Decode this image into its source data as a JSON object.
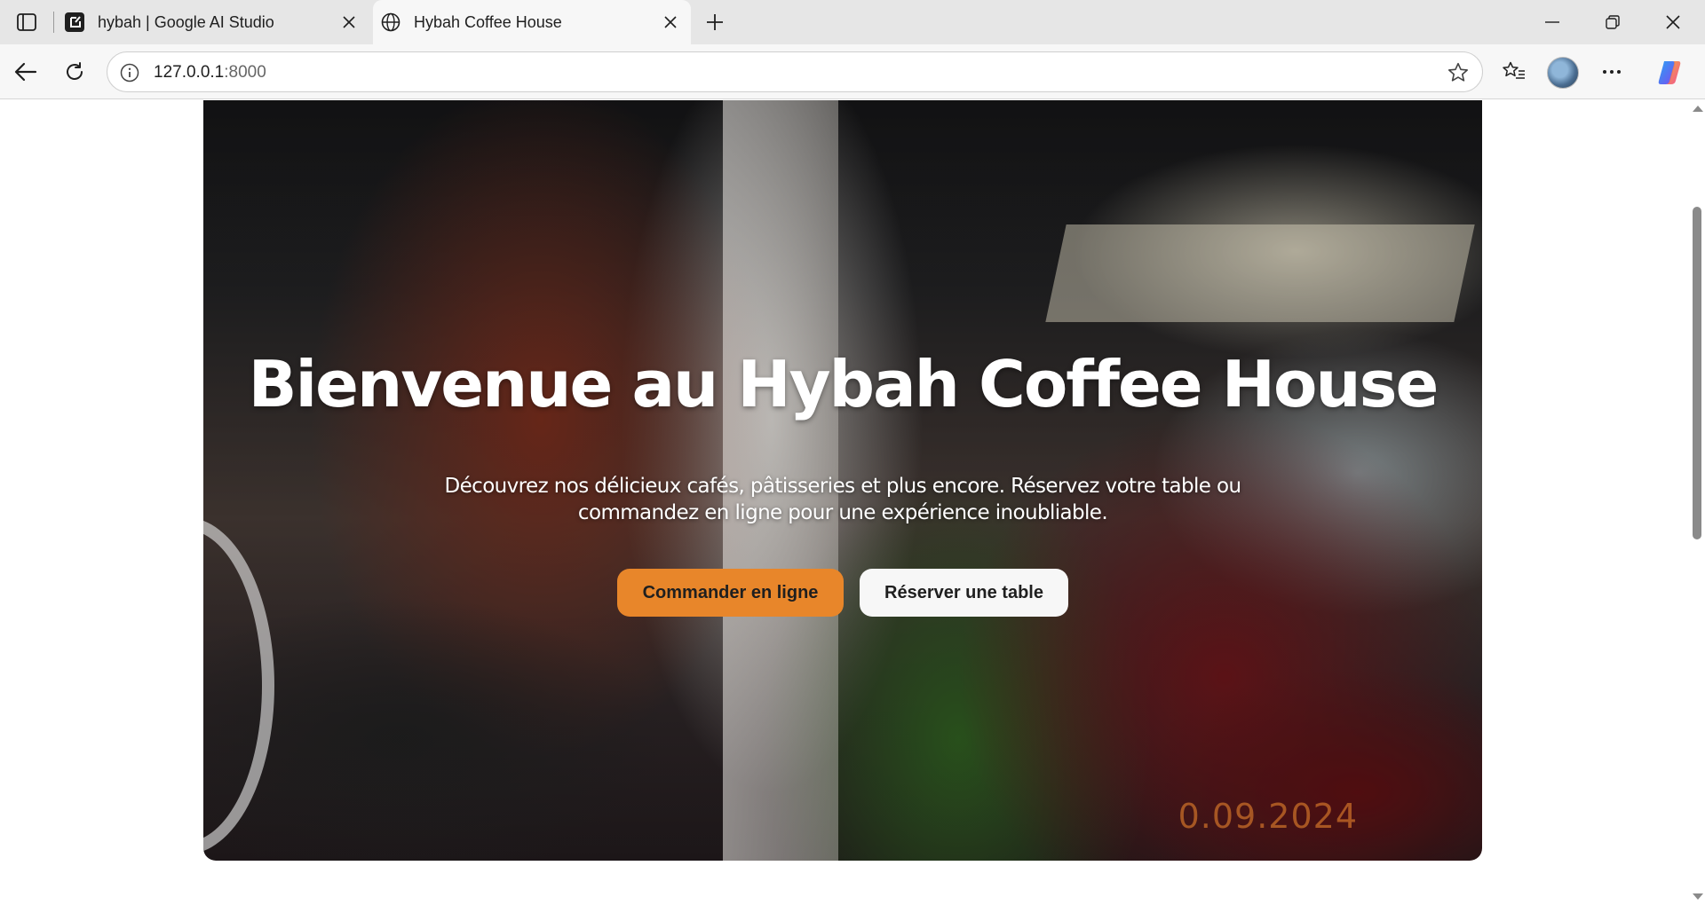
{
  "browser": {
    "tabs": [
      {
        "title": "hybah | Google AI Studio",
        "favicon": "ai-studio-icon",
        "active": false
      },
      {
        "title": "Hybah Coffee House",
        "favicon": "globe-icon",
        "active": true
      }
    ],
    "address": {
      "host": "127.0.0.1",
      "port": ":8000"
    },
    "icons": {
      "back": "back-arrow-icon",
      "reload": "reload-icon",
      "info": "info-icon",
      "favorite": "star-icon",
      "favorites": "favorites-icon",
      "profile": "avatar",
      "more": "more-icon",
      "copilot": "copilot-icon"
    }
  },
  "hero": {
    "title": "Bienvenue au Hybah Coffee House",
    "description": "Découvrez nos délicieux cafés, pâtisseries et plus encore. Réservez votre table ou commandez en ligne pour une expérience inoubliable.",
    "order_button": "Commander en ligne",
    "reserve_button": "Réserver une table",
    "photo_date": "0.09.2024"
  },
  "colors": {
    "accent": "#e8862a",
    "secondary_button": "#f7f7f7"
  }
}
